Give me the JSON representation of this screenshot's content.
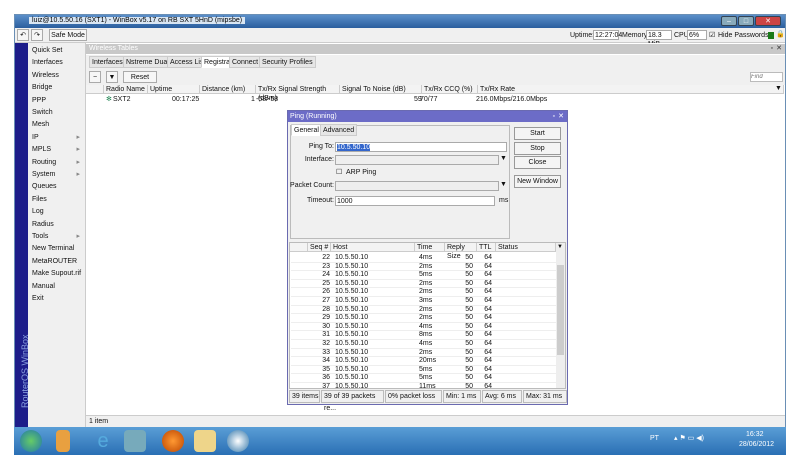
{
  "window": {
    "title": "luiz@10.5.50.16 (SXT1) - WinBox v5.17 on RB SXT 5HnD (mipsbe)"
  },
  "toolbar": {
    "undo": "↶",
    "redo": "↷",
    "safe_mode": "Safe Mode",
    "uptime_label": "Uptime:",
    "uptime": "12:27:04",
    "memory_label": "Memory:",
    "memory": "18.3 MiB",
    "cpu_label": "CPU:",
    "cpu": "6%",
    "hide_passwords": "Hide Passwords"
  },
  "sidebar": {
    "vertical_label": "RouterOS WinBox",
    "items": [
      {
        "label": "Quick Set"
      },
      {
        "label": "Interfaces"
      },
      {
        "label": "Wireless"
      },
      {
        "label": "Bridge"
      },
      {
        "label": "PPP"
      },
      {
        "label": "Switch"
      },
      {
        "label": "Mesh"
      },
      {
        "label": "IP",
        "arrow": true
      },
      {
        "label": "MPLS",
        "arrow": true
      },
      {
        "label": "Routing",
        "arrow": true
      },
      {
        "label": "System",
        "arrow": true
      },
      {
        "label": "Queues"
      },
      {
        "label": "Files"
      },
      {
        "label": "Log"
      },
      {
        "label": "Radius"
      },
      {
        "label": "Tools",
        "arrow": true
      },
      {
        "label": "New Terminal"
      },
      {
        "label": "MetaROUTER"
      },
      {
        "label": "Make Supout.rif"
      },
      {
        "label": "Manual"
      },
      {
        "label": "Exit"
      }
    ]
  },
  "wireless": {
    "title": "Wireless Tables",
    "tabs": [
      "Interfaces",
      "Nstreme Dual",
      "Access List",
      "Registration",
      "Connect List",
      "Security Profiles"
    ],
    "active_tab": 3,
    "reset": "Reset",
    "find_placeholder": "Find",
    "columns": [
      "Radio Name",
      "Uptime",
      "Distance (km)",
      "Tx/Rx Signal Strength (dBm)",
      "Signal To Noise (dB)",
      "Tx/Rx CCQ (%)",
      "Tx/Rx Rate"
    ],
    "row": {
      "radio_name": "SXT2",
      "uptime": "00:17:25",
      "distance": "1",
      "signal": "-58/-58",
      "snr": "59",
      "ccq": "70/77",
      "rate": "216.0Mbps/216.0Mbps"
    },
    "status": "1 item"
  },
  "ping": {
    "title": "Ping (Running)",
    "tabs": [
      "General",
      "Advanced"
    ],
    "ping_to_label": "Ping To:",
    "ping_to": "10.5.50.10",
    "interface_label": "Interface:",
    "arp_ping": "ARP Ping",
    "packet_count_label": "Packet Count:",
    "timeout_label": "Timeout:",
    "timeout": "1000",
    "timeout_unit": "ms",
    "buttons": {
      "start": "Start",
      "stop": "Stop",
      "close": "Close",
      "new_window": "New Window"
    },
    "columns": [
      "Seq #",
      "Host",
      "Time",
      "Reply Size",
      "TTL",
      "Status"
    ],
    "rows": [
      [
        "22",
        "10.5.50.10",
        "4ms",
        "50",
        "64"
      ],
      [
        "23",
        "10.5.50.10",
        "2ms",
        "50",
        "64"
      ],
      [
        "24",
        "10.5.50.10",
        "5ms",
        "50",
        "64"
      ],
      [
        "25",
        "10.5.50.10",
        "2ms",
        "50",
        "64"
      ],
      [
        "26",
        "10.5.50.10",
        "2ms",
        "50",
        "64"
      ],
      [
        "27",
        "10.5.50.10",
        "3ms",
        "50",
        "64"
      ],
      [
        "28",
        "10.5.50.10",
        "2ms",
        "50",
        "64"
      ],
      [
        "29",
        "10.5.50.10",
        "2ms",
        "50",
        "64"
      ],
      [
        "30",
        "10.5.50.10",
        "4ms",
        "50",
        "64"
      ],
      [
        "31",
        "10.5.50.10",
        "8ms",
        "50",
        "64"
      ],
      [
        "32",
        "10.5.50.10",
        "4ms",
        "50",
        "64"
      ],
      [
        "33",
        "10.5.50.10",
        "2ms",
        "50",
        "64"
      ],
      [
        "34",
        "10.5.50.10",
        "20ms",
        "50",
        "64"
      ],
      [
        "35",
        "10.5.50.10",
        "5ms",
        "50",
        "64"
      ],
      [
        "36",
        "10.5.50.10",
        "5ms",
        "50",
        "64"
      ],
      [
        "37",
        "10.5.50.10",
        "11ms",
        "50",
        "64"
      ]
    ],
    "status": {
      "items": "39 items",
      "received": "39 of 39 packets re...",
      "loss": "0% packet loss",
      "min": "Min: 1 ms",
      "avg": "Avg: 6 ms",
      "max": "Max: 31 ms"
    }
  },
  "taskbar": {
    "lang": "PT",
    "time": "16:32",
    "date": "28/06/2012"
  }
}
